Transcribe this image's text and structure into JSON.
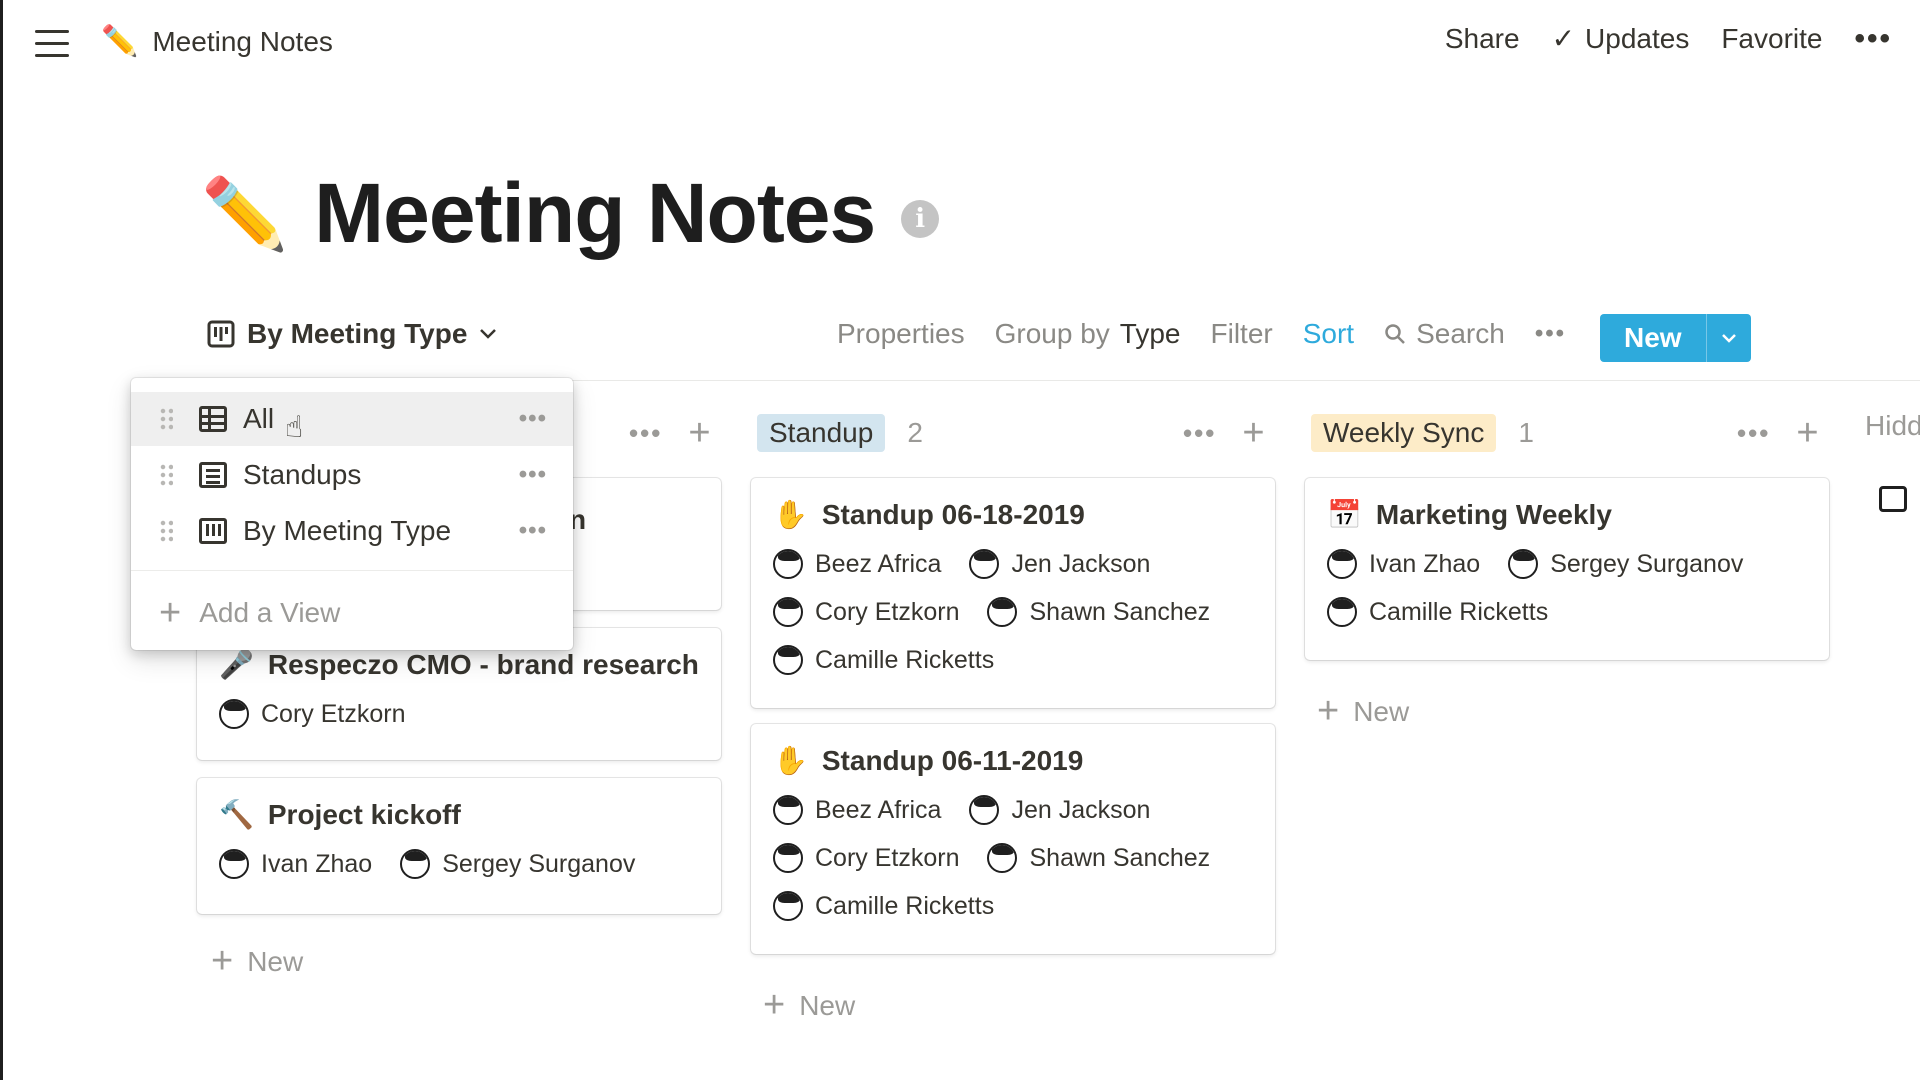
{
  "topbar": {
    "breadcrumb_emoji": "✏️",
    "breadcrumb_title": "Meeting Notes",
    "share": "Share",
    "updates_check": "✓",
    "updates": "Updates",
    "favorite": "Favorite",
    "more": "•••"
  },
  "page": {
    "emoji": "✏️",
    "title": "Meeting Notes",
    "info": "i"
  },
  "viewbar": {
    "current_view": "By Meeting Type",
    "properties": "Properties",
    "group_by": "Group by",
    "group_by_value": "Type",
    "filter": "Filter",
    "sort": "Sort",
    "search": "Search",
    "more": "•••",
    "new": "New",
    "new_arrow": "⌄"
  },
  "menu": {
    "items": [
      {
        "label": "All",
        "icon": "table-icon"
      },
      {
        "label": "Standups",
        "icon": "list-icon"
      },
      {
        "label": "By Meeting Type",
        "icon": "board-icon"
      }
    ],
    "more": "•••",
    "add_view": "Add a View",
    "plus": "+"
  },
  "board": {
    "col0": {
      "tools_dots": "•••",
      "tools_plus": "+",
      "partial_card_char": "n",
      "cards": [
        {
          "emoji": "🎤",
          "title": "Respeczo CMO - brand research",
          "people": [
            "Cory Etzkorn"
          ]
        },
        {
          "emoji": "🔨",
          "title": "Project kickoff",
          "people": [
            "Ivan Zhao",
            "Sergey Surganov"
          ]
        }
      ],
      "new": "New"
    },
    "col1": {
      "tag": "Standup",
      "tag_color": "#d3e5ef",
      "count": "2",
      "tools_dots": "•••",
      "tools_plus": "+",
      "cards": [
        {
          "emoji": "✋",
          "title": "Standup 06-18-2019",
          "people": [
            "Beez Africa",
            "Jen Jackson",
            "Cory Etzkorn",
            "Shawn Sanchez",
            "Camille Ricketts"
          ]
        },
        {
          "emoji": "✋",
          "title": "Standup 06-11-2019",
          "people": [
            "Beez Africa",
            "Jen Jackson",
            "Cory Etzkorn",
            "Shawn Sanchez",
            "Camille Ricketts"
          ]
        }
      ],
      "new": "New"
    },
    "col2": {
      "tag": "Weekly Sync",
      "tag_color": "#fdecc8",
      "count": "1",
      "tools_dots": "•••",
      "tools_plus": "+",
      "cards": [
        {
          "emoji": "📅",
          "title": "Marketing Weekly",
          "people": [
            "Ivan Zhao",
            "Sergey Surganov",
            "Camille Ricketts"
          ]
        }
      ],
      "new": "New"
    },
    "hidden_label": "Hidd"
  },
  "colors": {
    "accent": "#2eaadc",
    "text": "#37352f",
    "muted": "#9b9a97"
  }
}
